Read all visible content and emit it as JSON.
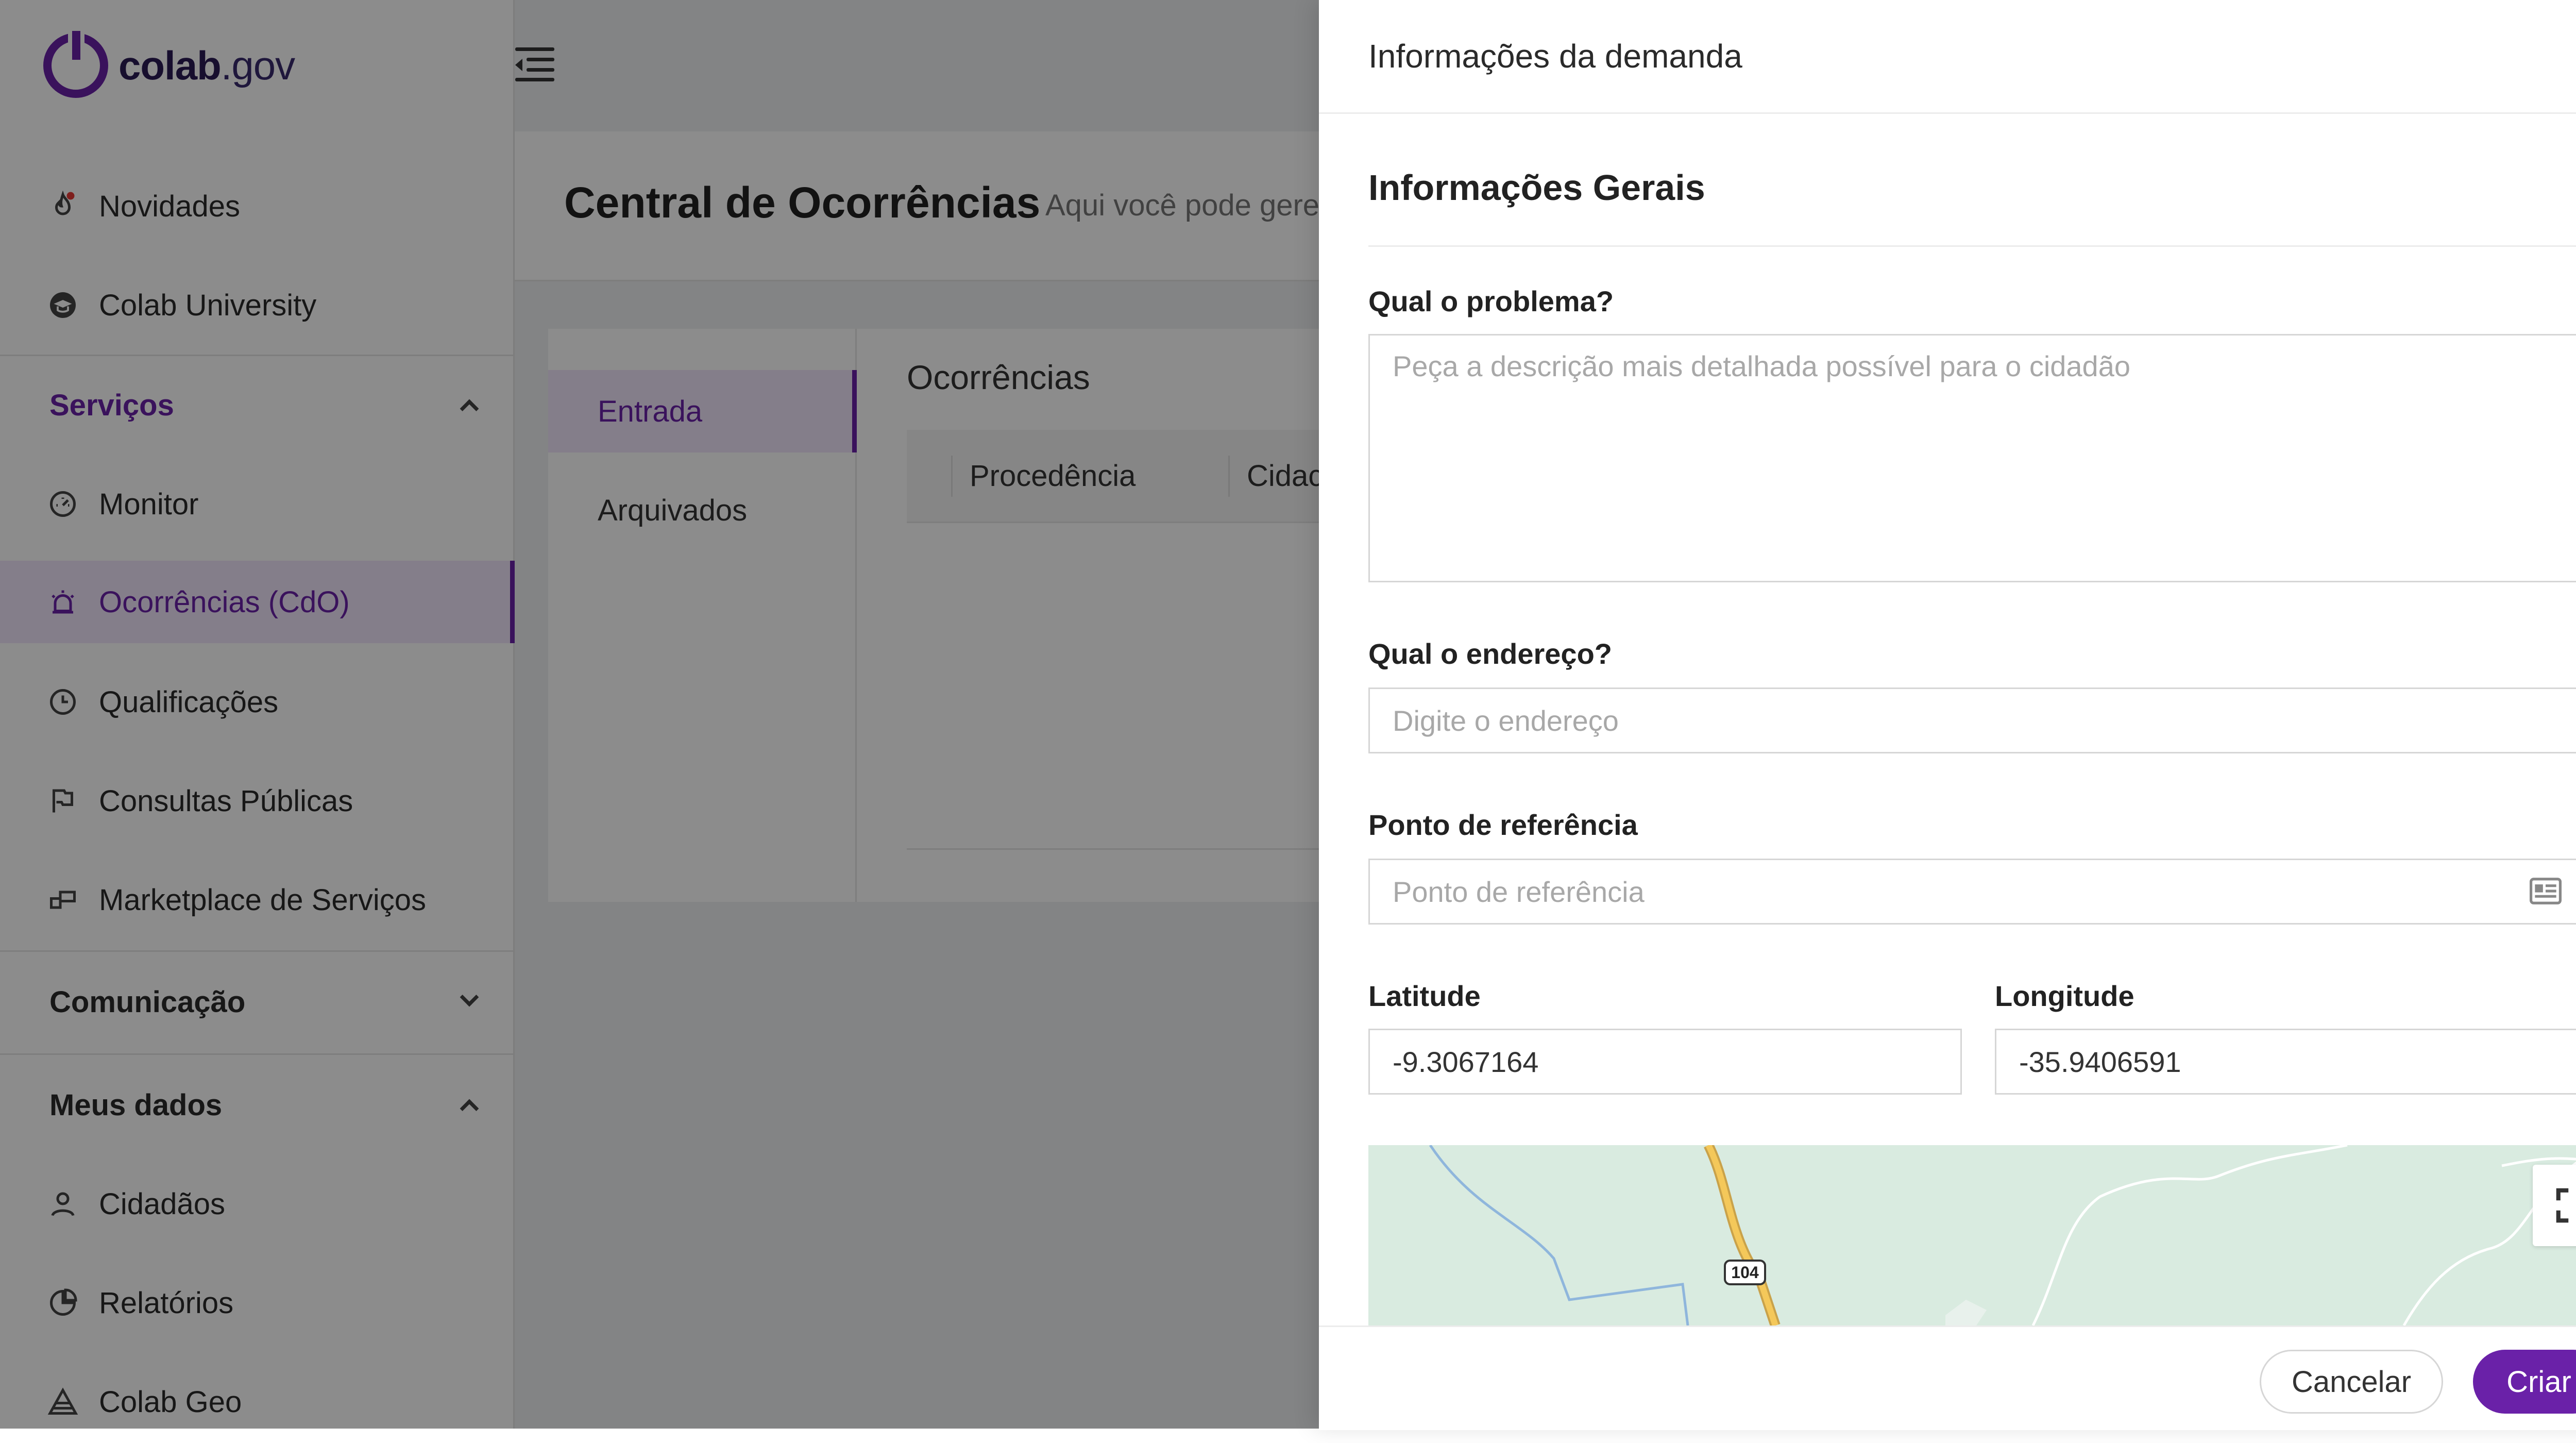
{
  "app": {
    "logo": {
      "brand": "colab",
      "suffix": ".gov"
    },
    "sidebar": {
      "items": [
        {
          "label": "Novidades",
          "icon": "flame-icon"
        },
        {
          "label": "Colab University",
          "icon": "graduation-icon"
        }
      ],
      "groups": [
        {
          "label": "Serviços",
          "expanded": true,
          "color": "#6a21a8",
          "items": [
            {
              "label": "Monitor",
              "icon": "gauge-icon"
            },
            {
              "label": "Ocorrências (CdO)",
              "icon": "alarm-light-icon",
              "active": true
            },
            {
              "label": "Qualificações",
              "icon": "pie-clock-icon"
            },
            {
              "label": "Consultas Públicas",
              "icon": "flag-icon"
            },
            {
              "label": "Marketplace de Serviços",
              "icon": "apps-icon"
            }
          ]
        },
        {
          "label": "Comunicação",
          "expanded": false,
          "items": []
        },
        {
          "label": "Meus dados",
          "expanded": true,
          "items": [
            {
              "label": "Cidadãos",
              "icon": "user-icon"
            },
            {
              "label": "Relatórios",
              "icon": "pie-chart-icon"
            },
            {
              "label": "Colab Geo",
              "icon": "pyramid-icon"
            }
          ]
        }
      ]
    },
    "header": {
      "title": "Central de Ocorrências",
      "subtitle": "Aqui você pode gere"
    },
    "cdo": {
      "tabs": [
        {
          "label": "Entrada",
          "active": true
        },
        {
          "label": "Arquivados",
          "active": false
        }
      ],
      "section_title": "Ocorrências",
      "columns": [
        "Procedência",
        "Cidac"
      ]
    }
  },
  "drawer": {
    "title": "Informações da demanda",
    "section_title": "Informações Gerais",
    "fields": {
      "problem": {
        "label": "Qual o problema?",
        "placeholder": "Peça a descrição mais detalhada possível para o cidadão",
        "value": ""
      },
      "address": {
        "label": "Qual o endereço?",
        "placeholder": "Digite o endereço",
        "value": ""
      },
      "reference": {
        "label": "Ponto de referência",
        "placeholder": "Ponto de referência",
        "value": "",
        "icon": "id-card-icon"
      },
      "latitude": {
        "label": "Latitude",
        "value": "-9.3067164"
      },
      "longitude": {
        "label": "Longitude",
        "value": "-35.9406591"
      }
    },
    "map": {
      "route_label": "104",
      "fullscreen_icon": "fullscreen-icon"
    },
    "footer": {
      "cancel_label": "Cancelar",
      "create_label": "Criar"
    }
  },
  "colors": {
    "accent": "#6a21a8",
    "overlay": "rgba(0,0,0,0.45)",
    "map_bg": "#d9ebe0"
  }
}
